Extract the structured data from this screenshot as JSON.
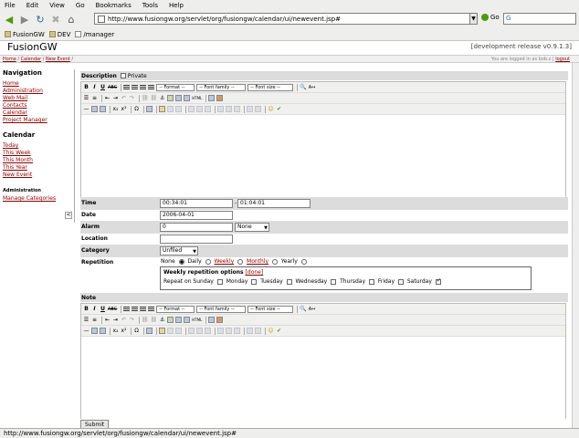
{
  "browser": {
    "menu": [
      "File",
      "Edit",
      "View",
      "Go",
      "Bookmarks",
      "Tools",
      "Help"
    ],
    "url": "http://www.fusiongw.org/servlet/org/fusiongw/calendar/ui/newevent.jsp#",
    "go_label": "Go",
    "bookmarks": [
      "FusionGW",
      "DEV",
      "/manager"
    ],
    "status": "http://www.fusiongw.org/servlet/org/fusiongw/calendar/ui/newevent.jsp#"
  },
  "app": {
    "title": "FusionGW",
    "release": "[development release v0.9.1.3]",
    "breadcrumb": [
      "Home",
      "Calendar",
      "New Event"
    ],
    "logged_in": "You are logged in as bob.z",
    "logout": "logout"
  },
  "sidebar": {
    "navigation_title": "Navigation",
    "nav": [
      "Home",
      "Administration",
      "Web Mail",
      "Contacts",
      "Calendar",
      "Project Manager"
    ],
    "calendar_title": "Calendar",
    "calendar": [
      "Today",
      "This Week",
      "This Month",
      "This Year",
      "New Event"
    ],
    "admin_title": "Administration",
    "admin": [
      "Manage Categories"
    ],
    "collapse": "<"
  },
  "form": {
    "description_label": "Description",
    "private_label": "Private",
    "toolbar": {
      "bold": "B",
      "italic": "I",
      "underline": "U",
      "strike": "ABC",
      "format": "-- Format --",
      "font_family": "-- Font family --",
      "font_size": "-- Font size --",
      "subscript": "x₂",
      "superscript": "x²",
      "omega": "Ω",
      "hr": "—",
      "source": "HTML",
      "anchor": "⚓"
    },
    "time_label": "Time",
    "time_start": "00:34:01",
    "time_sep": "-",
    "time_end": "01:04:01",
    "date_label": "Date",
    "date_value": "2006-04-01",
    "alarm_label": "Alarm",
    "alarm_value": "0",
    "alarm_unit": "None",
    "location_label": "Location",
    "location_value": "",
    "category_label": "Category",
    "category_value": "Unfiled",
    "repetition_label": "Repetition",
    "repetition_options": [
      "None",
      "Daily",
      "Weekly",
      "Monthly",
      "Yearly"
    ],
    "weekly_title": "Weekly repetition options",
    "weekly_done": "[done]",
    "weekly_days": [
      "Repeat on Sunday",
      "Monday",
      "Tuesday",
      "Wednesday",
      "Thursday",
      "Friday",
      "Saturday"
    ],
    "note_label": "Note",
    "submit_label": "Submit"
  }
}
